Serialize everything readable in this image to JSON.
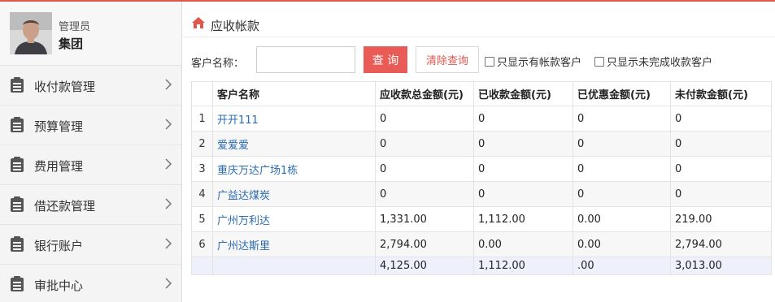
{
  "user": {
    "role": "管理员",
    "name": "集团"
  },
  "sidebar": {
    "items": [
      {
        "label": "收付款管理"
      },
      {
        "label": "预算管理"
      },
      {
        "label": "费用管理"
      },
      {
        "label": "借还款管理"
      },
      {
        "label": "银行账户"
      },
      {
        "label": "审批中心"
      }
    ]
  },
  "page": {
    "title": "应收帐款"
  },
  "search": {
    "label": "客户名称：",
    "value": "",
    "placeholder": "",
    "query_label": "查 询",
    "clear_label": "清除查询",
    "check_accounts_label": "只显示有帐款客户",
    "check_unfinished_label": "只显示未完成收款客户"
  },
  "table": {
    "columns": [
      "",
      "客户名称",
      "应收款总金额(元)",
      "已收款金额(元)",
      "已优惠金额(元)",
      "未付款金额(元)"
    ],
    "rows": [
      {
        "index": "1",
        "name": "开开111",
        "total": "0",
        "received": "0",
        "discount": "0",
        "unpaid": "0"
      },
      {
        "index": "2",
        "name": "爱爱爱",
        "total": "0",
        "received": "0",
        "discount": "0",
        "unpaid": "0"
      },
      {
        "index": "3",
        "name": "重庆万达广场1栋",
        "total": "0",
        "received": "0",
        "discount": "0",
        "unpaid": "0"
      },
      {
        "index": "4",
        "name": "广益达煤炭",
        "total": "0",
        "received": "0",
        "discount": "0",
        "unpaid": "0"
      },
      {
        "index": "5",
        "name": "广州万利达",
        "total": "1,331.00",
        "received": "1,112.00",
        "discount": "0.00",
        "unpaid": "219.00"
      },
      {
        "index": "6",
        "name": "广州达斯里",
        "total": "2,794.00",
        "received": "0.00",
        "discount": "0.00",
        "unpaid": "2,794.00"
      }
    ],
    "totals": {
      "total": "4,125.00",
      "received": "1,112.00",
      "discount": ".00",
      "unpaid": "3,013.00"
    }
  },
  "colors": {
    "accent": "#e85b57",
    "link": "#2a6bb0",
    "sidebar_bg": "#f4f4f4",
    "total_row_bg": "#eef1fb"
  },
  "icons": {
    "menu": "list-icon",
    "chevron": "chevron-right-icon",
    "home": "home-icon"
  }
}
